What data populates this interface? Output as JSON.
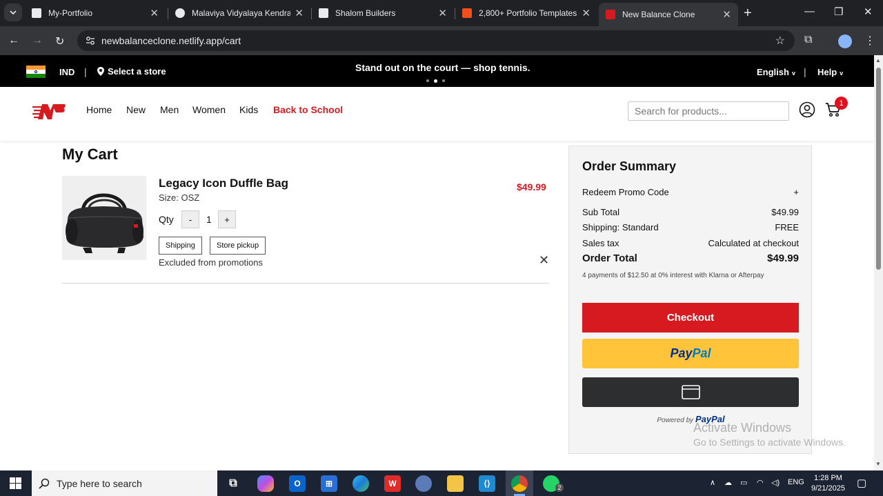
{
  "browser": {
    "tabs": [
      {
        "title": "My-Portfolio",
        "favicon_color": "#e8eaed",
        "active": false
      },
      {
        "title": "Malaviya Vidyalaya Kendram",
        "favicon_color": "#e8eaed",
        "active": false
      },
      {
        "title": "Shalom Builders",
        "favicon_color": "#e8eaed",
        "active": false
      },
      {
        "title": "2,800+ Portfolio Templates -",
        "favicon_color": "#f24e1e",
        "active": false
      },
      {
        "title": "New Balance Clone",
        "favicon_color": "#d71920",
        "active": true
      }
    ],
    "url": "newbalanceclone.netlify.app/cart"
  },
  "promo_bar": {
    "country": "IND",
    "select_store": "Select a store",
    "message": "Stand out on the court — shop tennis.",
    "language": "English",
    "help": "Help"
  },
  "header": {
    "nav": [
      "Home",
      "New",
      "Men",
      "Women",
      "Kids",
      "Back to School"
    ],
    "search_placeholder": "Search for products...",
    "cart_count": "1",
    "accent_color": "#d71920"
  },
  "cart": {
    "title": "My Cart",
    "items": [
      {
        "name": "Legacy Icon Duffle Bag",
        "size": "Size: OSZ",
        "price": "$49.99",
        "qty_label": "Qty",
        "qty_minus": "-",
        "qty": "1",
        "qty_plus": "+",
        "option_shipping": "Shipping",
        "option_pickup": "Store pickup",
        "note": "Excluded from promotions",
        "remove": "✕"
      }
    ]
  },
  "summary": {
    "title": "Order Summary",
    "promo_label": "Redeem Promo Code",
    "promo_toggle": "+",
    "rows": [
      {
        "label": "Sub Total",
        "value": "$49.99"
      },
      {
        "label": "Shipping: Standard",
        "value": "FREE"
      },
      {
        "label": "Sales tax",
        "value": "Calculated at checkout"
      }
    ],
    "total_label": "Order Total",
    "total_value": "$49.99",
    "installment": "4 payments of $12.50 at 0% interest with Klarna or Afterpay",
    "checkout": "Checkout",
    "paypal_a": "Pay",
    "paypal_b": "Pal",
    "powered_by": "Powered by",
    "powered_brand": "PayPal"
  },
  "watermark": {
    "line1": "Activate Windows",
    "line2": "Go to Settings to activate Windows."
  },
  "taskbar": {
    "search_placeholder": "Type here to search",
    "language": "ENG",
    "time": "1:28 PM",
    "date": "9/21/2025",
    "whatsapp_badge": "2"
  }
}
